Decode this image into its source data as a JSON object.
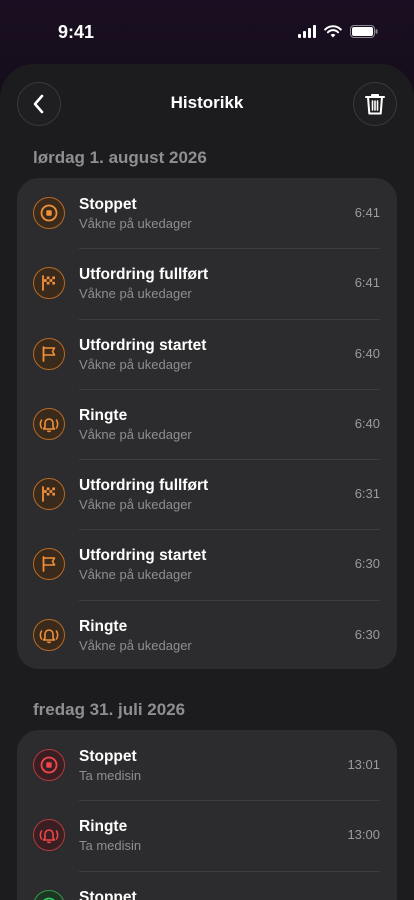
{
  "status_bar": {
    "time": "9:41"
  },
  "header": {
    "title": "Historikk",
    "back_icon": "chevron-left-icon",
    "delete_icon": "trash-icon"
  },
  "sections": [
    {
      "date": "lørdag 1. august 2026",
      "entries": [
        {
          "title": "Stoppet",
          "subtitle": "Våkne på ukedager",
          "time": "6:41",
          "icon": "stop-icon",
          "color": "orange"
        },
        {
          "title": "Utfordring fullført",
          "subtitle": "Våkne på ukedager",
          "time": "6:41",
          "icon": "checkered-flag-icon",
          "color": "orange"
        },
        {
          "title": "Utfordring startet",
          "subtitle": "Våkne på ukedager",
          "time": "6:40",
          "icon": "flag-icon",
          "color": "orange"
        },
        {
          "title": "Ringte",
          "subtitle": "Våkne på ukedager",
          "time": "6:40",
          "icon": "bell-ringing-icon",
          "color": "orange"
        },
        {
          "title": "Utfordring fullført",
          "subtitle": "Våkne på ukedager",
          "time": "6:31",
          "icon": "checkered-flag-icon",
          "color": "orange"
        },
        {
          "title": "Utfordring startet",
          "subtitle": "Våkne på ukedager",
          "time": "6:30",
          "icon": "flag-icon",
          "color": "orange"
        },
        {
          "title": "Ringte",
          "subtitle": "Våkne på ukedager",
          "time": "6:30",
          "icon": "bell-ringing-icon",
          "color": "orange"
        }
      ]
    },
    {
      "date": "fredag 31. juli 2026",
      "entries": [
        {
          "title": "Stoppet",
          "subtitle": "Ta medisin",
          "time": "13:01",
          "icon": "stop-icon",
          "color": "red"
        },
        {
          "title": "Ringte",
          "subtitle": "Ta medisin",
          "time": "13:00",
          "icon": "bell-ringing-icon",
          "color": "red"
        },
        {
          "title": "Stoppet",
          "subtitle": "",
          "time": "",
          "icon": "stop-icon",
          "color": "green"
        }
      ]
    }
  ],
  "colors": {
    "orange": "#f0913a",
    "red": "#f0474b",
    "green": "#34c759"
  }
}
